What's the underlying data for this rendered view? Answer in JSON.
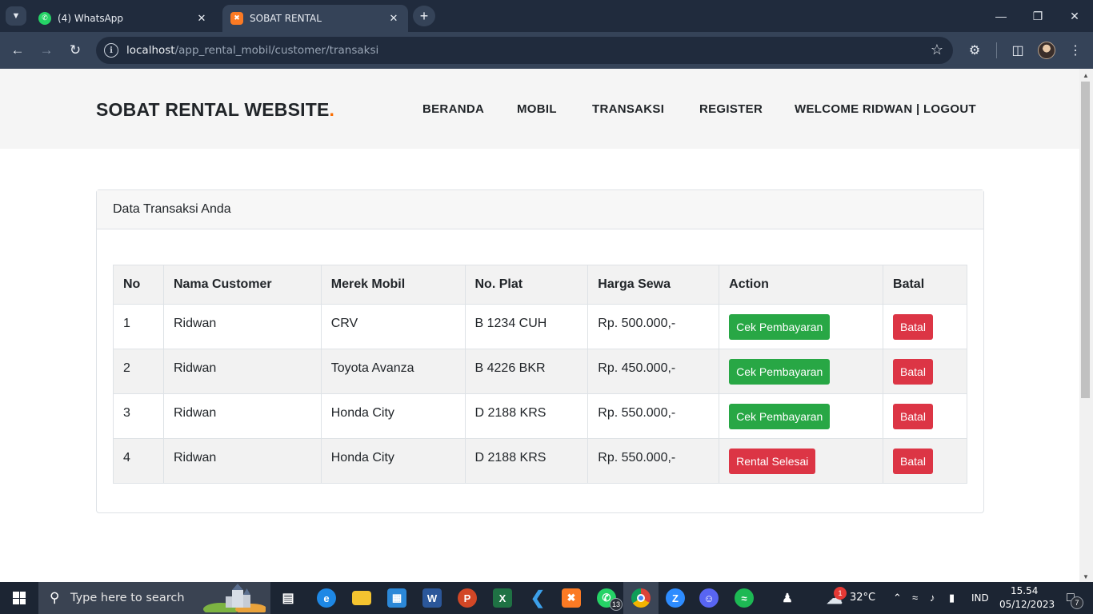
{
  "browser": {
    "tabs": [
      {
        "title": "(4) WhatsApp",
        "favicon": "whatsapp-icon",
        "active": false
      },
      {
        "title": "SOBAT RENTAL",
        "favicon": "xampp-icon",
        "active": true
      }
    ],
    "url_host": "localhost",
    "url_path": "/app_rental_mobil/customer/transaksi"
  },
  "site": {
    "brand": "SOBAT RENTAL WEBSITE",
    "brand_dot": ".",
    "nav": {
      "beranda": "BERANDA",
      "mobil": "MOBIL",
      "transaksi": "TRANSAKSI",
      "register": "REGISTER",
      "welcome": "WELCOME RIDWAN | LOGOUT"
    }
  },
  "card": {
    "title": "Data Transaksi Anda",
    "columns": [
      "No",
      "Nama Customer",
      "Merek Mobil",
      "No. Plat",
      "Harga Sewa",
      "Action",
      "Batal"
    ],
    "rows": [
      {
        "no": "1",
        "customer": "Ridwan",
        "mobil": "CRV",
        "plat": "B 1234 CUH",
        "harga": "Rp. 500.000,-",
        "action": "Cek Pembayaran",
        "batal": "Batal"
      },
      {
        "no": "2",
        "customer": "Ridwan",
        "mobil": "Toyota Avanza",
        "plat": "B 4226 BKR",
        "harga": "Rp. 450.000,-",
        "action": "Cek Pembayaran",
        "batal": "Batal"
      },
      {
        "no": "3",
        "customer": "Ridwan",
        "mobil": "Honda City",
        "plat": "D 2188 KRS",
        "harga": "Rp. 550.000,-",
        "action": "Cek Pembayaran",
        "batal": "Batal"
      },
      {
        "no": "4",
        "customer": "Ridwan",
        "mobil": "Honda City",
        "plat": "D 2188 KRS",
        "harga": "Rp. 550.000,-",
        "action": "Rental Selesai",
        "batal": "Batal"
      }
    ]
  },
  "taskbar": {
    "search_placeholder": "Type here to search",
    "whatsapp_badge": "13",
    "weather": "32°C",
    "weather_badge": "1",
    "language": "IND",
    "time": "15.54",
    "date": "05/12/2023",
    "notification_count": "7"
  },
  "colors": {
    "success": "#28a745",
    "danger": "#dc3545",
    "brand_dot": "#f96d00"
  }
}
